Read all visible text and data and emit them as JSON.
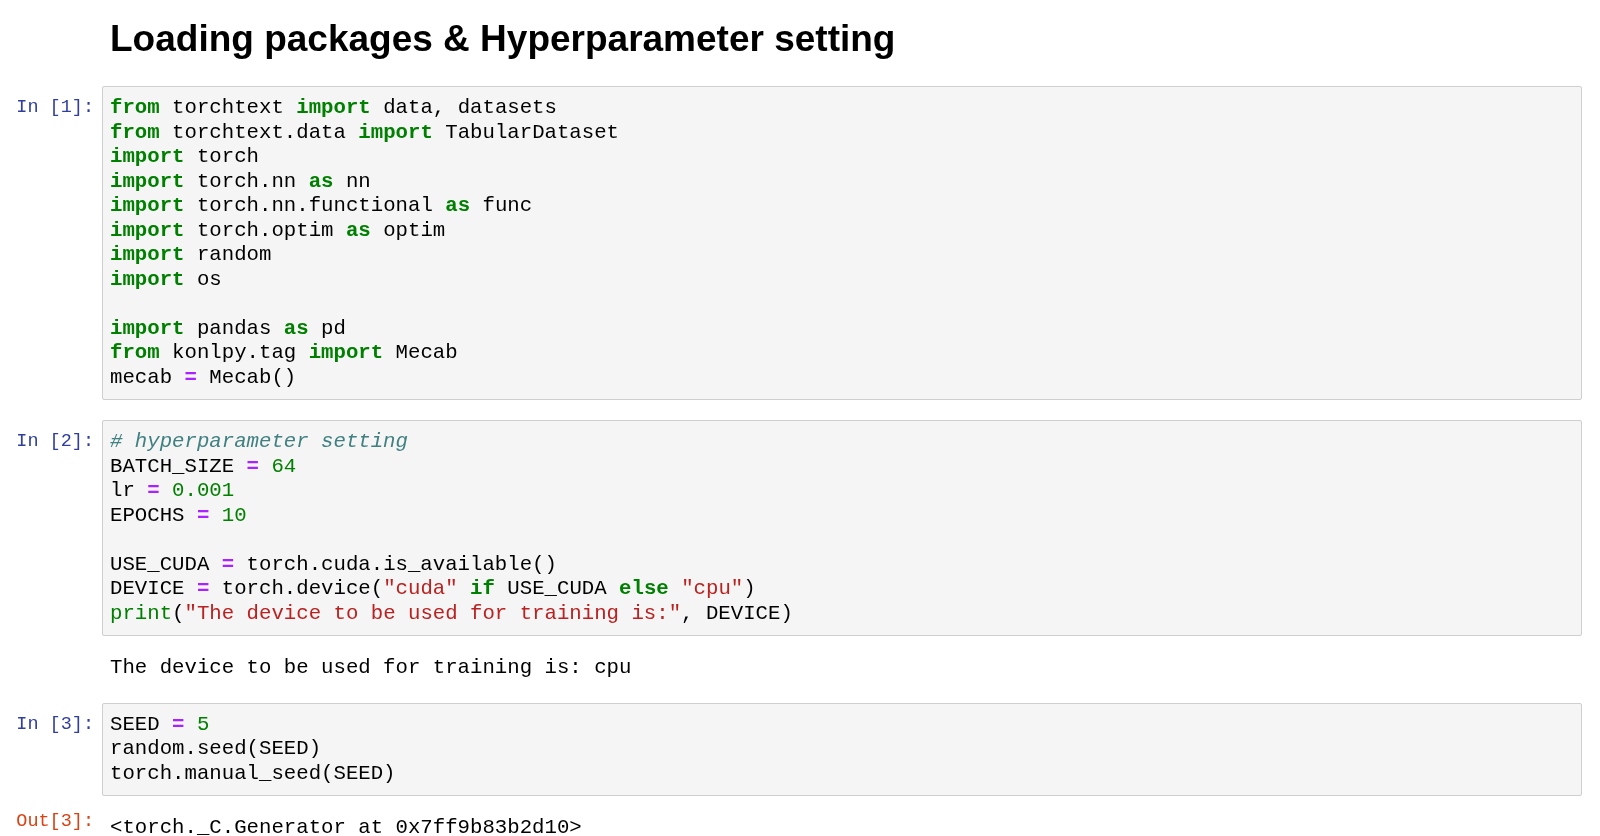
{
  "heading": "Loading packages & Hyperparameter setting",
  "cells": [
    {
      "prompt": "In [1]:",
      "blocks": [
        [
          [
            {
              "kind": "kw",
              "text": "from"
            },
            {
              "kind": "p",
              "text": " torchtext "
            },
            {
              "kind": "kw",
              "text": "import"
            },
            {
              "kind": "p",
              "text": " data, datasets"
            }
          ],
          [
            {
              "kind": "kw",
              "text": "from"
            },
            {
              "kind": "p",
              "text": " torchtext.data "
            },
            {
              "kind": "kw",
              "text": "import"
            },
            {
              "kind": "p",
              "text": " TabularDataset"
            }
          ],
          [
            {
              "kind": "kw",
              "text": "import"
            },
            {
              "kind": "p",
              "text": " torch"
            }
          ],
          [
            {
              "kind": "kw",
              "text": "import"
            },
            {
              "kind": "p",
              "text": " torch.nn "
            },
            {
              "kind": "kw",
              "text": "as"
            },
            {
              "kind": "p",
              "text": " nn"
            }
          ],
          [
            {
              "kind": "kw",
              "text": "import"
            },
            {
              "kind": "p",
              "text": " torch.nn.functional "
            },
            {
              "kind": "kw",
              "text": "as"
            },
            {
              "kind": "p",
              "text": " func"
            }
          ],
          [
            {
              "kind": "kw",
              "text": "import"
            },
            {
              "kind": "p",
              "text": " torch.optim "
            },
            {
              "kind": "kw",
              "text": "as"
            },
            {
              "kind": "p",
              "text": " optim"
            }
          ],
          [
            {
              "kind": "kw",
              "text": "import"
            },
            {
              "kind": "p",
              "text": " random"
            }
          ],
          [
            {
              "kind": "kw",
              "text": "import"
            },
            {
              "kind": "p",
              "text": " os"
            }
          ]
        ],
        [
          [
            {
              "kind": "kw",
              "text": "import"
            },
            {
              "kind": "p",
              "text": " pandas "
            },
            {
              "kind": "kw",
              "text": "as"
            },
            {
              "kind": "p",
              "text": " pd"
            }
          ],
          [
            {
              "kind": "kw",
              "text": "from"
            },
            {
              "kind": "p",
              "text": " konlpy.tag "
            },
            {
              "kind": "kw",
              "text": "import"
            },
            {
              "kind": "p",
              "text": " Mecab"
            }
          ],
          [
            {
              "kind": "p",
              "text": "mecab "
            },
            {
              "kind": "op",
              "text": "="
            },
            {
              "kind": "p",
              "text": " Mecab()"
            }
          ]
        ]
      ]
    },
    {
      "prompt": "In [2]:",
      "blocks": [
        [
          [
            {
              "kind": "cm",
              "text": "# hyperparameter setting"
            }
          ],
          [
            {
              "kind": "p",
              "text": "BATCH_SIZE "
            },
            {
              "kind": "op",
              "text": "="
            },
            {
              "kind": "num",
              "text": " 64"
            }
          ],
          [
            {
              "kind": "p",
              "text": "lr "
            },
            {
              "kind": "op",
              "text": "="
            },
            {
              "kind": "num",
              "text": " 0.001"
            }
          ],
          [
            {
              "kind": "p",
              "text": "EPOCHS "
            },
            {
              "kind": "op",
              "text": "="
            },
            {
              "kind": "num",
              "text": " 10"
            }
          ]
        ],
        [
          [
            {
              "kind": "p",
              "text": "USE_CUDA "
            },
            {
              "kind": "op",
              "text": "="
            },
            {
              "kind": "p",
              "text": " torch.cuda.is_available()"
            }
          ],
          [
            {
              "kind": "p",
              "text": "DEVICE "
            },
            {
              "kind": "op",
              "text": "="
            },
            {
              "kind": "p",
              "text": " torch.device("
            },
            {
              "kind": "str",
              "text": "\"cuda\""
            },
            {
              "kind": "kw",
              "text": " if"
            },
            {
              "kind": "p",
              "text": " USE_CUDA "
            },
            {
              "kind": "kw",
              "text": "else"
            },
            {
              "kind": "str",
              "text": " \"cpu\""
            },
            {
              "kind": "p",
              "text": ")"
            }
          ],
          [
            {
              "kind": "bi",
              "text": "print"
            },
            {
              "kind": "p",
              "text": "("
            },
            {
              "kind": "str",
              "text": "\"The device to be used for training is:\""
            },
            {
              "kind": "p",
              "text": ", DEVICE)"
            }
          ]
        ]
      ],
      "output": {
        "text": "The device to be used for training is: cpu"
      }
    },
    {
      "prompt": "In [3]:",
      "blocks": [
        [
          [
            {
              "kind": "p",
              "text": "SEED "
            },
            {
              "kind": "op",
              "text": "="
            },
            {
              "kind": "num",
              "text": " 5"
            }
          ],
          [
            {
              "kind": "p",
              "text": "random.seed(SEED)"
            }
          ],
          [
            {
              "kind": "p",
              "text": "torch.manual_seed(SEED)"
            }
          ]
        ]
      ],
      "output": {
        "prompt": "Out[3]:",
        "text": "<torch._C.Generator at 0x7ff9b83b2d10>"
      }
    }
  ]
}
